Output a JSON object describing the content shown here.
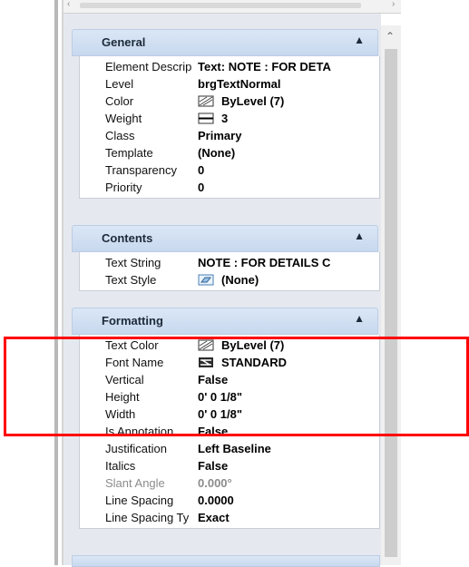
{
  "groups": {
    "general": {
      "title": "General",
      "rows": [
        {
          "label": "Element Descrip",
          "value": "Text: NOTE :  FOR DETA"
        },
        {
          "label": "Level",
          "value": "brgTextNormal"
        },
        {
          "label": "Color",
          "value": "ByLevel (7)",
          "icon": "color-swatch-icon"
        },
        {
          "label": "Weight",
          "value": "3",
          "icon": "line-weight-icon"
        },
        {
          "label": "Class",
          "value": "Primary"
        },
        {
          "label": "Template",
          "value": "(None)"
        },
        {
          "label": "Transparency",
          "value": "0"
        },
        {
          "label": "Priority",
          "value": "0"
        }
      ]
    },
    "contents": {
      "title": "Contents",
      "rows": [
        {
          "label": "Text String",
          "value": "NOTE :  FOR DETAILS C"
        },
        {
          "label": "Text Style",
          "value": "(None)",
          "icon": "text-style-icon"
        }
      ]
    },
    "formatting": {
      "title": "Formatting",
      "rows": [
        {
          "label": "Text Color",
          "value": "ByLevel (7)",
          "icon": "color-swatch-icon"
        },
        {
          "label": "Font Name",
          "value": "STANDARD",
          "icon": "font-icon"
        },
        {
          "label": "Vertical",
          "value": "False"
        },
        {
          "label": "Height",
          "value": "0' 0 1/8\""
        },
        {
          "label": "Width",
          "value": "0' 0 1/8\""
        },
        {
          "label": "Is Annotation",
          "value": "False"
        },
        {
          "label": "Justification",
          "value": "Left Baseline"
        },
        {
          "label": "Italics",
          "value": "False"
        },
        {
          "label": "Slant Angle",
          "value": "0.000°",
          "greyed": true
        },
        {
          "label": "Line Spacing",
          "value": "0.0000"
        },
        {
          "label": "Line Spacing Ty",
          "value": "Exact"
        }
      ]
    }
  },
  "colors": {
    "header_gradient_top": "#dbe7f6",
    "header_gradient_bottom": "#c7d8ee",
    "highlight": "#ff0000"
  }
}
